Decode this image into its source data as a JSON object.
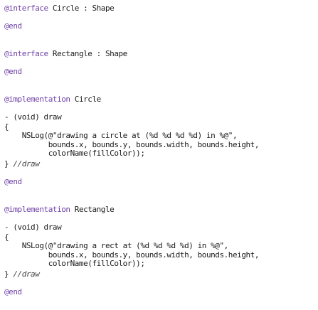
{
  "lines": [
    {
      "dir": "@interface",
      "rest": " Circle : Shape"
    },
    {
      "dir": "@end",
      "rest": ""
    },
    {
      "dir": "@interface",
      "rest": " Rectangle : Shape"
    },
    {
      "dir": "@end",
      "rest": ""
    },
    {
      "dir": "@implementation",
      "rest": " Circle"
    },
    {
      "text": "- (void) draw"
    },
    {
      "text": "{"
    },
    {
      "text": "    NSLog(@\"drawing a circle at (%d %d %d %d) in %@\","
    },
    {
      "text": "          bounds.x, bounds.y, bounds.width, bounds.height,"
    },
    {
      "text": "          colorName(fillColor));"
    },
    {
      "code": "} ",
      "comment": "//draw"
    },
    {
      "dir": "@end",
      "rest": ""
    },
    {
      "dir": "@implementation",
      "rest": " Rectangle"
    },
    {
      "text": "- (void) draw"
    },
    {
      "text": "{"
    },
    {
      "text": "    NSLog(@\"drawing a rect at (%d %d %d %d) in %@\","
    },
    {
      "text": "          bounds.x, bounds.y, bounds.width, bounds.height,"
    },
    {
      "text": "          colorName(fillColor));"
    },
    {
      "code": "} ",
      "comment": "//draw"
    },
    {
      "dir": "@end",
      "rest": ""
    }
  ]
}
